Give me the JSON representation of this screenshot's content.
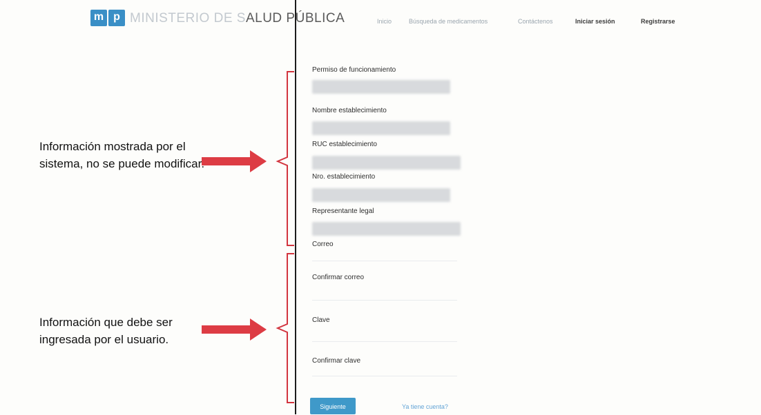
{
  "header": {
    "logo_m": "m",
    "logo_p": "p",
    "brand_part1": "MINISTERIO DE S",
    "brand_part2": "ALUD PÚBLICA",
    "nav": {
      "inicio": "Inicio",
      "busqueda": "Búsqueda de medicamentos",
      "contactenos": "Contáctenos",
      "login": "Iniciar sesión",
      "register": "Registrarse"
    }
  },
  "form": {
    "permiso_label": "Permiso de funcionamiento",
    "nombre_label": "Nombre establecimiento",
    "ruc_label": "RUC establecimiento",
    "nro_label": "Nro. establecimiento",
    "representante_label": "Representante legal",
    "correo_label": "Correo",
    "confirmar_correo_label": "Confirmar correo",
    "clave_label": "Clave",
    "confirmar_clave_label": "Confirmar clave",
    "next_button": "Siguiente",
    "account_link": "Ya tiene cuenta?"
  },
  "annotations": {
    "readonly_note": "Información mostrada por el sistema, no se puede modificar.",
    "user_input_note": "Información que debe ser ingresada por el usuario."
  },
  "colors": {
    "arrow": "#dd3c44",
    "brand_blue": "#3a8fc6",
    "button_blue": "#3f99c9"
  }
}
